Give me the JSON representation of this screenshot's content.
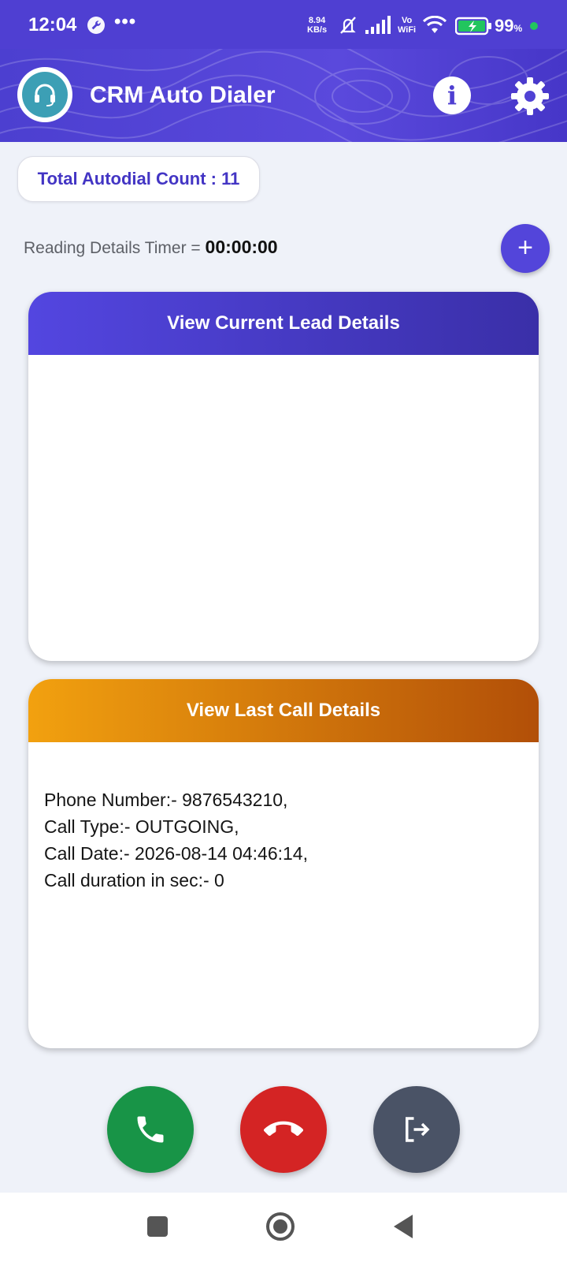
{
  "status_bar": {
    "time": "12:04",
    "more": "•••",
    "net_speed_value": "8.94",
    "net_speed_unit": "KB/s",
    "vo": "Vo",
    "wifi": "WiFi",
    "battery": "99",
    "battery_unit": "%"
  },
  "header": {
    "title": "CRM Auto Dialer",
    "info_label": "i"
  },
  "autodial": {
    "count_text": "Total Autodial Count : 11"
  },
  "timer": {
    "label": "Reading Details Timer = ",
    "value": "00:00:00"
  },
  "add_button": {
    "label": "+"
  },
  "lead_card": {
    "title": "View Current Lead Details"
  },
  "last_call_card": {
    "title": "View Last Call Details",
    "lines": [
      "Phone Number:- 9876543210,",
      "Call Type:- OUTGOING,",
      "Call Date:- 2026-08-14 04:46:14,",
      "Call duration in sec:- 0"
    ]
  },
  "colors": {
    "primary": "#4f3fd2",
    "orange": "#f2a10f",
    "call_green": "#189447",
    "hangup_red": "#d42424",
    "logout_gray": "#4a5366"
  },
  "icons": [
    "wrench-icon",
    "mute-icon",
    "signal-icon",
    "wifi-icon",
    "battery-icon",
    "headset-icon",
    "info-icon",
    "gear-icon",
    "plus-icon",
    "phone-icon",
    "hangup-icon",
    "logout-icon"
  ]
}
